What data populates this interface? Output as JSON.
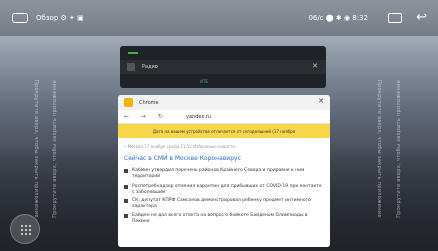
{
  "statusbar": {
    "title": "Обзор",
    "title_icons": "⚙ ✦ ▣",
    "right_text": "06/с ⬤ ✱ ◉ 8:32",
    "recent_icon": "recent-apps-icon",
    "back_icon": "back-arrow-icon",
    "home_icon": "home-icon"
  },
  "side_hints": {
    "left_1": "Прокрутите вверх, чтобы закрыть приложение",
    "left_2": "Прокрутите вверх, чтобы закрыть приложение",
    "right_1": "Прокрутите вверх, чтобы закрыть приложение",
    "right_2": "Прокрутите вверх, чтобы закрыть приложение"
  },
  "back_card": {
    "app_name": "Радио",
    "close": "✕",
    "bottom_text": "ИТБ"
  },
  "chrome_card": {
    "app_name": "Chrome",
    "close": "✕",
    "nav": "← → ↻",
    "url": "yandex.ru",
    "notice": "Дата на вашем устройстве отличается от сегодняшней (17 ноября",
    "meta": "• Москва   17 ноября среда 11:52   Избранные новости",
    "headline": "Сейчас в СМИ в Москве Коронавирус",
    "news": [
      "Кабмин утвердил перечень районов Крайнего Севера и приравне к ним территорий",
      "Роспотребнадзор отменил карантин для прибывших от COVID-19 при контакте с заболевшим",
      "СК: депутат КПРФ Самсонов демонстрировал ребенку предмет интимного характера",
      "Байден не дал всего ответа на вопрос о бойкоте Байденом Олимпиады в Пекине"
    ]
  },
  "fab": {
    "icon": "grid-dots-icon"
  }
}
